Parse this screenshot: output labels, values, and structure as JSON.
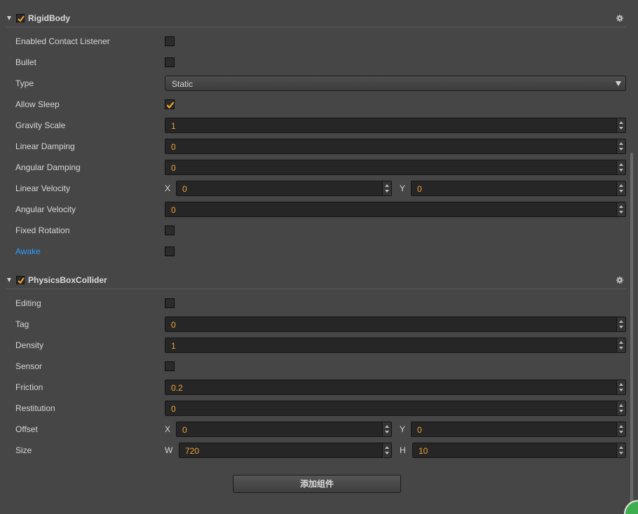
{
  "rigidbody": {
    "title": "RigidBody",
    "enabled": true,
    "rows": {
      "enabled_contact_listener": {
        "label": "Enabled Contact Listener",
        "checked": false
      },
      "bullet": {
        "label": "Bullet",
        "checked": false
      },
      "type": {
        "label": "Type",
        "value": "Static"
      },
      "allow_sleep": {
        "label": "Allow Sleep",
        "checked": true
      },
      "gravity_scale": {
        "label": "Gravity Scale",
        "value": "1"
      },
      "linear_damping": {
        "label": "Linear Damping",
        "value": "0"
      },
      "angular_damping": {
        "label": "Angular Damping",
        "value": "0"
      },
      "linear_velocity": {
        "label": "Linear Velocity",
        "x_label": "X",
        "x": "0",
        "y_label": "Y",
        "y": "0"
      },
      "angular_velocity": {
        "label": "Angular Velocity",
        "value": "0"
      },
      "fixed_rotation": {
        "label": "Fixed Rotation",
        "checked": false
      },
      "awake": {
        "label": "Awake",
        "checked": false
      }
    }
  },
  "physics_box_collider": {
    "title": "PhysicsBoxCollider",
    "enabled": true,
    "rows": {
      "editing": {
        "label": "Editing",
        "checked": false
      },
      "tag": {
        "label": "Tag",
        "value": "0"
      },
      "density": {
        "label": "Density",
        "value": "1"
      },
      "sensor": {
        "label": "Sensor",
        "checked": false
      },
      "friction": {
        "label": "Friction",
        "value": "0.2"
      },
      "restitution": {
        "label": "Restitution",
        "value": "0"
      },
      "offset": {
        "label": "Offset",
        "x_label": "X",
        "x": "0",
        "y_label": "Y",
        "y": "0"
      },
      "size": {
        "label": "Size",
        "w_label": "W",
        "w": "720",
        "h_label": "H",
        "h": "10"
      }
    }
  },
  "add_component_label": "添加组件",
  "colors": {
    "background": "#464646",
    "field_background": "#262626",
    "number_text": "#f0a43a",
    "highlight_label": "#2a9bff",
    "check_mark": "#f5a031"
  },
  "icons": {
    "fold": "triangle-down-icon",
    "settings": "gear-icon",
    "check": "check-icon",
    "spinner": "up-down-arrows-icon",
    "dropdown": "triangle-down-icon"
  }
}
